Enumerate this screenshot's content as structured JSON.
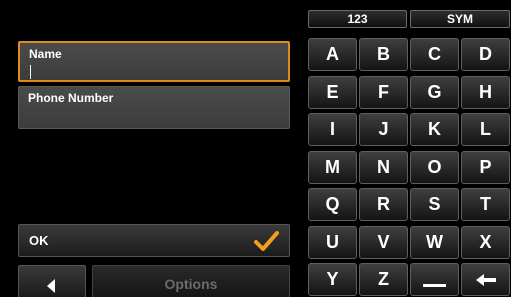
{
  "form": {
    "name_label": "Name",
    "name_value": "",
    "phone_label": "Phone Number",
    "phone_value": ""
  },
  "actions": {
    "ok_label": "OK",
    "options_label": "Options",
    "check_icon": "checkmark-icon",
    "back_icon": "left-arrow-icon"
  },
  "keyboard": {
    "mode_numeric": "123",
    "mode_symbols": "SYM",
    "rows": [
      [
        "A",
        "B",
        "C",
        "D"
      ],
      [
        "E",
        "F",
        "G",
        "H"
      ],
      [
        "I",
        "J",
        "K",
        "L"
      ],
      [
        "M",
        "N",
        "O",
        "P"
      ],
      [
        "Q",
        "R",
        "S",
        "T"
      ],
      [
        "U",
        "V",
        "W",
        "X"
      ],
      [
        "Y",
        "Z"
      ]
    ],
    "space_icon": "underscore-icon",
    "backspace_icon": "backspace-arrow-icon"
  },
  "colors": {
    "accent": "#e08a1e",
    "check": "#f0a020",
    "background": "#000000"
  }
}
